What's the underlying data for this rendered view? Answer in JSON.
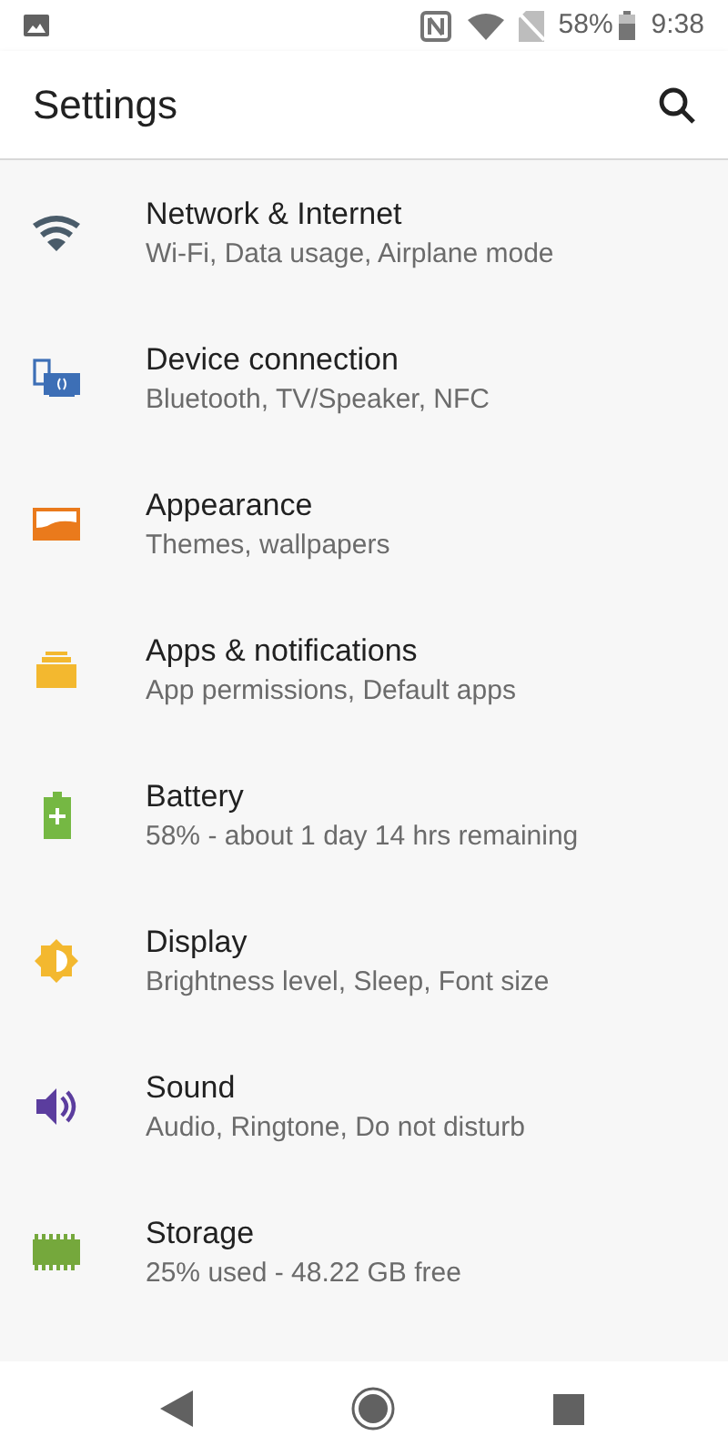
{
  "status_bar": {
    "battery_percent": "58%",
    "time": "9:38"
  },
  "header": {
    "title": "Settings"
  },
  "items": [
    {
      "kind": "wifi",
      "title": "Network & Internet",
      "subtitle": "Wi-Fi, Data usage, Airplane mode"
    },
    {
      "kind": "device",
      "title": "Device connection",
      "subtitle": "Bluetooth, TV/Speaker, NFC"
    },
    {
      "kind": "appearance",
      "title": "Appearance",
      "subtitle": "Themes, wallpapers"
    },
    {
      "kind": "apps",
      "title": "Apps & notifications",
      "subtitle": "App permissions, Default apps"
    },
    {
      "kind": "battery",
      "title": "Battery",
      "subtitle": "58% - about 1 day 14 hrs remaining"
    },
    {
      "kind": "display",
      "title": "Display",
      "subtitle": "Brightness level, Sleep, Font size"
    },
    {
      "kind": "sound",
      "title": "Sound",
      "subtitle": "Audio, Ringtone, Do not disturb"
    },
    {
      "kind": "storage",
      "title": "Storage",
      "subtitle": "25% used - 48.22 GB free"
    }
  ]
}
